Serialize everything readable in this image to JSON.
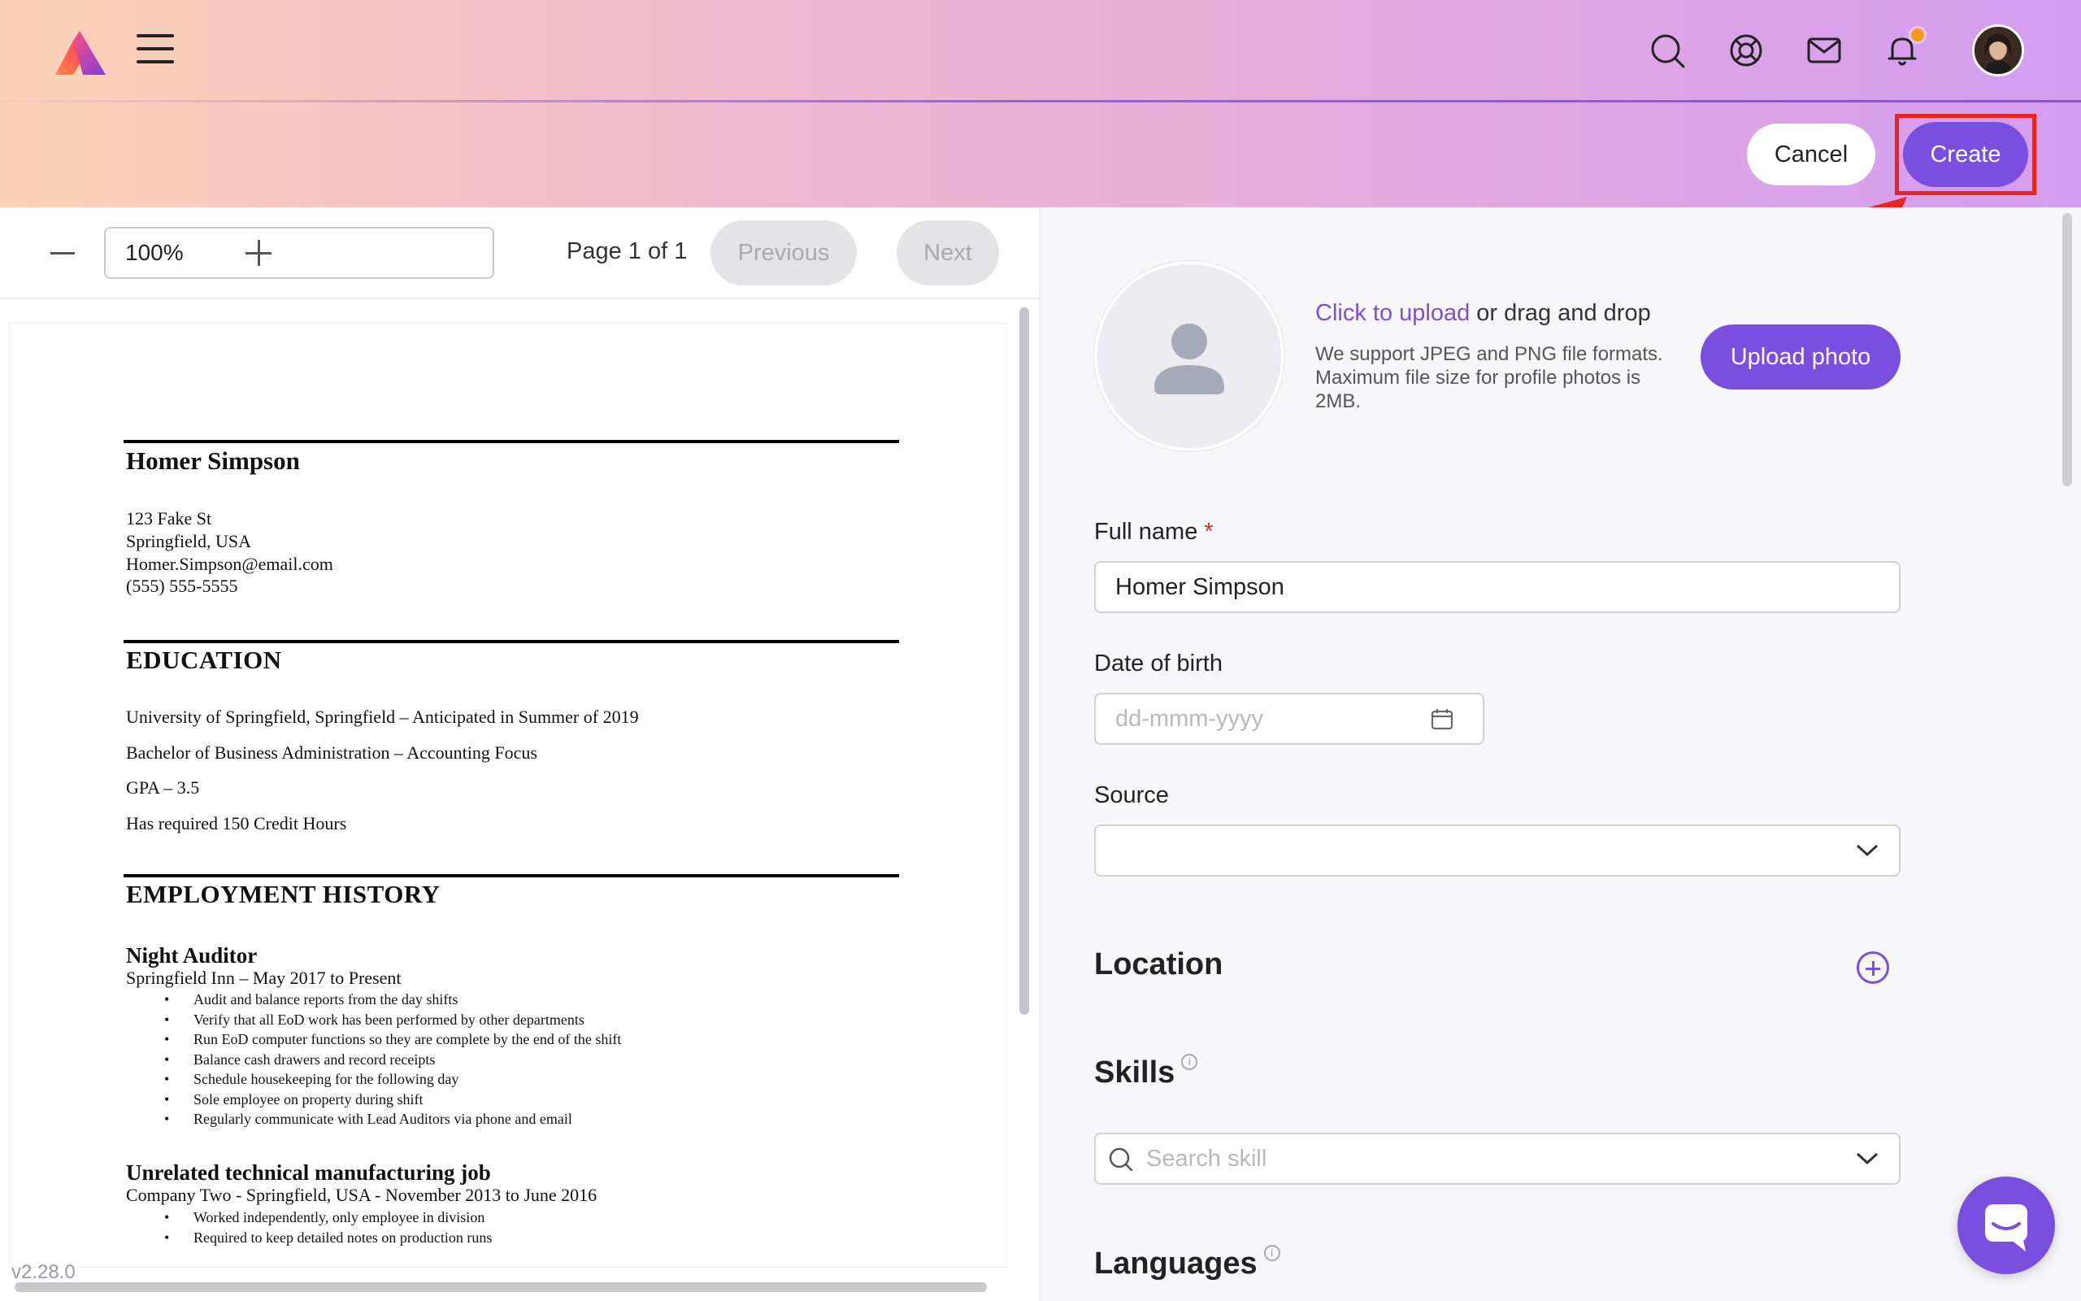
{
  "header": {
    "cancel_label": "Cancel",
    "create_label": "Create",
    "icons": [
      "search-icon",
      "help-lifebuoy-icon",
      "mail-icon",
      "bell-icon"
    ],
    "notification_dot_color": "#f59a1a"
  },
  "pdf_viewer": {
    "zoom_value": "100%",
    "page_indicator": "Page 1 of 1",
    "previous_label": "Previous",
    "next_label": "Next",
    "version": "v2.28.0",
    "resume": {
      "name": "Homer Simpson",
      "contact": [
        "123 Fake St",
        "Springfield, USA",
        "Homer.Simpson@email.com",
        "(555) 555-5555"
      ],
      "education_title": "EDUCATION",
      "education_lines": [
        "University of Springfield, Springfield – Anticipated in Summer of 2019",
        "Bachelor of Business Administration – Accounting Focus",
        "GPA – 3.5",
        "Has required 150 Credit Hours"
      ],
      "employment_title": "EMPLOYMENT HISTORY",
      "jobs": [
        {
          "title": "Night Auditor",
          "subtitle": "Springfield Inn – May 2017 to Present",
          "bullets": [
            "Audit and balance reports from the day shifts",
            "Verify that all EoD work has been performed by other departments",
            "Run EoD computer functions so they are complete by the end of the shift",
            "Balance cash drawers and record receipts",
            "Schedule housekeeping for the following day",
            "Sole employee on property during shift",
            "Regularly communicate with Lead Auditors via phone and email"
          ]
        },
        {
          "title": "Unrelated technical manufacturing job",
          "subtitle": "Company Two - Springfield, USA - November 2013 to June 2016",
          "bullets": [
            "Worked independently, only employee in division",
            "Required to keep detailed notes on production runs"
          ]
        }
      ]
    }
  },
  "form": {
    "upload_link": "Click to upload",
    "upload_rest": " or drag and drop",
    "upload_help": "We support JPEG and PNG file formats. Maximum file size for profile photos is 2MB.",
    "upload_button": "Upload photo",
    "full_name_label": "Full name",
    "required_mark": "*",
    "full_name_value": "Homer Simpson",
    "dob_label": "Date of birth",
    "dob_placeholder": "dd-mmm-yyyy",
    "source_label": "Source",
    "source_value": "",
    "location_title": "Location",
    "skills_title": "Skills",
    "skills_placeholder": "Search skill",
    "languages_title": "Languages",
    "info_glyph": "i"
  },
  "colors": {
    "accent": "#7a4fe0",
    "highlight_box": "#e8261f",
    "header_gradient": [
      "#fcd2b6",
      "#f2bccb",
      "#e6addb",
      "#d49df0"
    ]
  }
}
